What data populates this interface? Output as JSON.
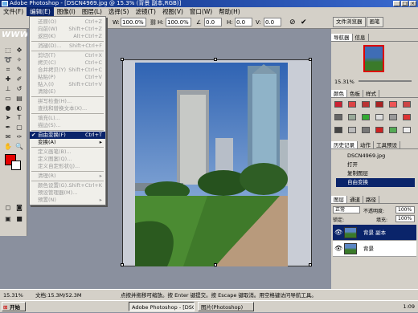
{
  "window": {
    "title": "Adobe Photoshop - [DSCN4969.jpg @ 15.3% (背景 副本,RGB)]",
    "min": "_",
    "max": "□",
    "close": "×"
  },
  "menubar": [
    "文件(F)",
    "编辑(E)",
    "图像(I)",
    "图层(L)",
    "选择(S)",
    "滤镜(T)",
    "视图(V)",
    "窗口(W)",
    "帮助(H)"
  ],
  "menubar_active_index": 1,
  "options": {
    "w_label": "W:",
    "w_value": "100.0%",
    "h_label": "H:",
    "h_value": "100.0%",
    "angle_value": "0.0",
    "h2_label": "H:",
    "h2_value": "0.0",
    "v_label": "V:",
    "v_value": "0.0"
  },
  "top_tabs": [
    "文件浏览器",
    "画笔"
  ],
  "watermark": "WWW.CNCOAST.COM",
  "edit_menu": [
    {
      "label": "还原(O)",
      "shortcut": "Ctrl+Z",
      "enabled": false
    },
    {
      "label": "向前(W)",
      "shortcut": "Shift+Ctrl+Z",
      "enabled": false
    },
    {
      "label": "返回(K)",
      "shortcut": "Alt+Ctrl+Z",
      "enabled": false
    },
    {
      "sep": true
    },
    {
      "label": "消褪(D)...",
      "shortcut": "Shift+Ctrl+F",
      "enabled": false
    },
    {
      "sep": true
    },
    {
      "label": "剪切(T)",
      "shortcut": "Ctrl+X",
      "enabled": false
    },
    {
      "label": "拷贝(C)",
      "shortcut": "Ctrl+C",
      "enabled": false
    },
    {
      "label": "合并拷贝(Y)",
      "shortcut": "Shift+Ctrl+C",
      "enabled": false
    },
    {
      "label": "粘贴(P)",
      "shortcut": "Ctrl+V",
      "enabled": false
    },
    {
      "label": "贴入(I)",
      "shortcut": "Shift+Ctrl+V",
      "enabled": false
    },
    {
      "label": "清除(E)",
      "shortcut": "",
      "enabled": false
    },
    {
      "sep": true
    },
    {
      "label": "拼写检查(H)...",
      "shortcut": "",
      "enabled": false
    },
    {
      "label": "查找和替换文本(X)...",
      "shortcut": "",
      "enabled": false
    },
    {
      "sep": true
    },
    {
      "label": "填充(L)...",
      "shortcut": "",
      "enabled": false
    },
    {
      "label": "描边(S)...",
      "shortcut": "",
      "enabled": false
    },
    {
      "sep": true
    },
    {
      "label": "自由变换(F)",
      "shortcut": "Ctrl+T",
      "enabled": true,
      "selected": true,
      "checked": true
    },
    {
      "label": "变换(A)",
      "shortcut": "",
      "enabled": true,
      "submenu": true
    },
    {
      "sep": true
    },
    {
      "label": "定义画笔(B)...",
      "shortcut": "",
      "enabled": false
    },
    {
      "label": "定义图案(Q)...",
      "shortcut": "",
      "enabled": false
    },
    {
      "label": "定义自定形状(J)...",
      "shortcut": "",
      "enabled": false
    },
    {
      "sep": true
    },
    {
      "label": "清理(R)",
      "shortcut": "",
      "enabled": false,
      "submenu": true
    },
    {
      "sep": true
    },
    {
      "label": "颜色设置(G)...",
      "shortcut": "Shift+Ctrl+K",
      "enabled": false
    },
    {
      "label": "预设管理器(M)...",
      "shortcut": "",
      "enabled": false
    },
    {
      "label": "预置(N)",
      "shortcut": "",
      "enabled": false,
      "submenu": true
    }
  ],
  "navigator": {
    "tabs": [
      "导航器",
      "信息"
    ],
    "zoom": "15.31%"
  },
  "color_panel": {
    "tabs": [
      "颜色",
      "色板",
      "样式"
    ]
  },
  "history_panel": {
    "tabs": [
      "历史记录",
      "动作",
      "工具预设"
    ],
    "items": [
      "DSCN4969.jpg",
      "打开",
      "复制图层",
      "自由变换"
    ],
    "selected_index": 3
  },
  "layers_panel": {
    "tabs": [
      "图层",
      "通道",
      "路径"
    ],
    "blend_mode": "正常",
    "opacity_label": "不透明度:",
    "opacity": "100%",
    "lock_label": "锁定:",
    "fill_label": "填充:",
    "fill": "100%",
    "layers": [
      {
        "name": "背景 副本",
        "selected": true
      },
      {
        "name": "背景",
        "selected": false
      }
    ]
  },
  "status": {
    "zoom": "15.31%",
    "doc": "文档:15.3M/52.3M",
    "hint": "点按并拖移可缩放。按 Enter 键提交。按 Escape 键取消。用空格键访问导航工具。"
  },
  "taskbar": {
    "start": "开始",
    "tasks": [
      "Adobe Photoshop - [DSC...",
      "图片(Photoshop)"
    ],
    "clock": "1:09"
  },
  "icons": {
    "start": "windows-flag-icon",
    "checked": "checkmark-icon",
    "visibility": "eye-icon"
  },
  "colors": {
    "accent": "#0a246a",
    "foreground": "#e40000",
    "background": "#ffffff"
  }
}
